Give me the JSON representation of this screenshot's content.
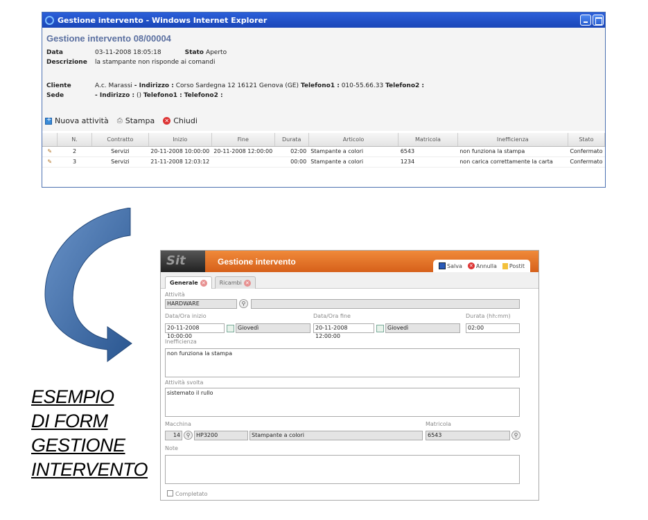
{
  "ie": {
    "title": "Gestione intervento - Windows Internet Explorer",
    "heading": "Gestione intervento 08/00004",
    "data_label": "Data",
    "data_value": "03-11-2008 18:05:18",
    "stato_label": "Stato",
    "stato_value": "Aperto",
    "descr_label": "Descrizione",
    "descr_value": "la stampante non risponde ai comandi",
    "cliente_label": "Cliente",
    "cliente_name": "A.c. Marassi",
    "indirizzo_label": "- Indirizzo :",
    "indirizzo_value": "Corso Sardegna 12 16121 Genova (GE)",
    "tel1_label": "Telefono1 :",
    "tel1_value": "010-55.66.33",
    "tel2_label": "Telefono2 :",
    "sede_label": "Sede",
    "sede_indirizzo": "- Indirizzo :",
    "sede_paren": "()",
    "sede_tel1": "Telefono1 :",
    "sede_tel2": "Telefono2 :",
    "toolbar": {
      "nuova": "Nuova attività",
      "stampa": "Stampa",
      "chiudi": "Chiudi"
    },
    "columns": [
      "N.",
      "Contratto",
      "Inizio",
      "Fine",
      "Durata",
      "Articolo",
      "Matricola",
      "Inefficienza",
      "Stato"
    ],
    "rows": [
      {
        "n": "2",
        "contratto": "Servizi",
        "inizio": "20-11-2008 10:00:00",
        "fine": "20-11-2008 12:00:00",
        "durata": "02:00",
        "articolo": "Stampante a colori",
        "matricola": "6543",
        "inefficienza": "non funziona la stampa",
        "stato": "Confermato"
      },
      {
        "n": "3",
        "contratto": "Servizi",
        "inizio": "21-11-2008 12:03:12",
        "fine": "",
        "durata": "00:00",
        "articolo": "Stampante a colori",
        "matricola": "1234",
        "inefficienza": "non carica correttamente la carta",
        "stato": "Confermato"
      }
    ]
  },
  "caption": {
    "line1": "ESEMPIO",
    "line2": "DI FORM",
    "line3": "GESTIONE",
    "line4": "INTERVENTO"
  },
  "form": {
    "logo": "Sit",
    "title": "Gestione intervento",
    "salva": "Salva",
    "annulla": "Annulla",
    "postit": "Postit",
    "tab_generale": "Generale",
    "tab_ricambi": "Ricambi",
    "attivita_label": "Attività",
    "attivita_value": "HARDWARE",
    "data_inizio_label": "Data/Ora inizio",
    "data_inizio_value": "20-11-2008 10:00:00",
    "giorno_inizio": "Giovedì",
    "data_fine_label": "Data/Ora fine",
    "data_fine_value": "20-11-2008 12:00:00",
    "giorno_fine": "Giovedì",
    "durata_label": "Durata (hh:mm)",
    "durata_value": "02:00",
    "inefficienza_label": "Inefficienza",
    "inefficienza_value": "non funziona la stampa",
    "attivita_svolta_label": "Attività svolta",
    "attivita_svolta_value": "sistemato il rullo",
    "macchina_label": "Macchina",
    "macchina_num": "14",
    "macchina_code": "HP3200",
    "macchina_desc": "Stampante a colori",
    "matricola_label": "Matricola",
    "matricola_value": "6543",
    "note_label": "Note",
    "completato_label": "Completato"
  }
}
